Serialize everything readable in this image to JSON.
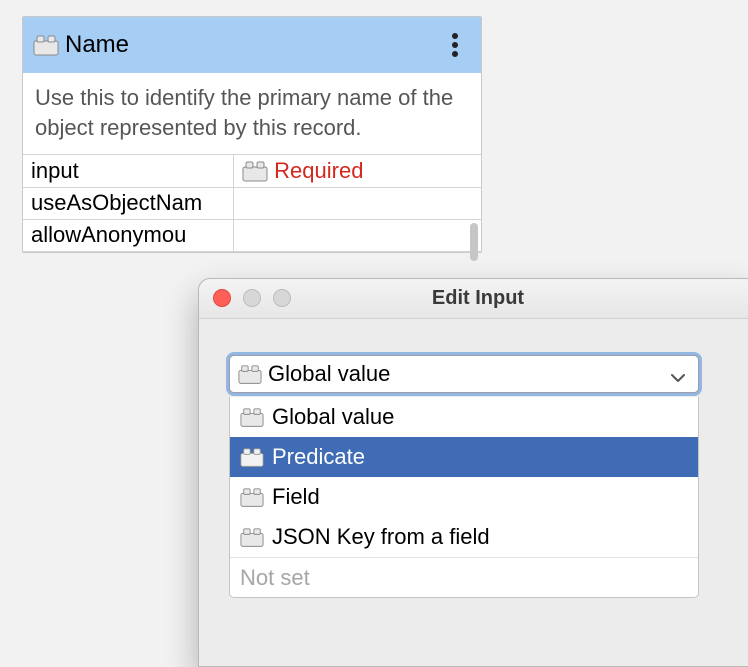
{
  "card": {
    "title": "Name",
    "description": "Use this to identify the primary name of the object represented by this record.",
    "rows": [
      {
        "key": "input",
        "value": "Required",
        "required": true,
        "hasIcon": true
      },
      {
        "key": "useAsObjectNam",
        "value": "",
        "required": false,
        "hasIcon": false
      },
      {
        "key": "allowAnonymou",
        "value": "",
        "required": false,
        "hasIcon": false
      }
    ]
  },
  "modal": {
    "title": "Edit Input",
    "selected": "Global value",
    "options": [
      "Global value",
      "Predicate",
      "Field",
      "JSON Key from a field"
    ],
    "highlighted_index": 1,
    "not_set_label": "Not set"
  }
}
